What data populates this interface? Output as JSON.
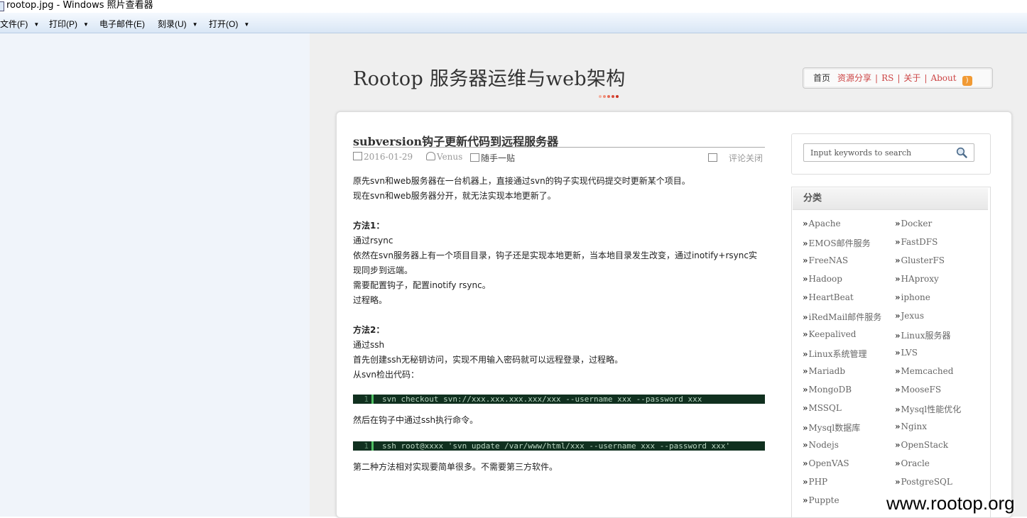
{
  "window": {
    "title": "rootop.jpg - Windows 照片查看器"
  },
  "menubar": [
    {
      "label": "文件(F)",
      "has_dropdown": true
    },
    {
      "label": "打印(P)",
      "has_dropdown": true
    },
    {
      "label": "电子邮件(E)",
      "has_dropdown": false
    },
    {
      "label": "刻录(U)",
      "has_dropdown": true
    },
    {
      "label": "打开(O)",
      "has_dropdown": true
    }
  ],
  "site": {
    "title": "Rootop 服务器运维与web架构",
    "nav": {
      "home": "首页",
      "links": [
        "资源分享",
        "RS",
        "关于",
        "About"
      ],
      "rss_icon": "rss-icon"
    }
  },
  "post": {
    "title": "subversion钩子更新代码到远程服务器",
    "date": "2016-01-29",
    "author": "Venus",
    "category": "随手一贴",
    "comments": "评论关闭",
    "paragraphs": [
      "原先svn和web服务器在一台机器上，直接通过svn的钩子实现代码提交时更新某个项目。",
      "现在svn和web服务器分开，就无法实现本地更新了。",
      "",
      "方法1：",
      "通过rsync",
      "依然在svn服务器上有一个项目目录，钩子还是实现本地更新，当本地目录发生改变，通过inotify+rsync实现同步到远端。",
      "需要配置钩子，配置inotify rsync。",
      "过程略。",
      "",
      "方法2：",
      "通过ssh",
      "首先创建ssh无秘钥访问，实现不用输入密码就可以远程登录，过程略。",
      "从svn检出代码："
    ],
    "code1": {
      "line": "1",
      "text": "svn checkout svn://xxx.xxx.xxx.xxx/xxx --username xxx --password xxx"
    },
    "after_code1": "然后在钩子中通过ssh执行命令。",
    "code2": {
      "line": "1",
      "text": "ssh root@xxxx 'svn update /var/www/html/xxx --username xxx --password xxx'"
    },
    "closing": "第二种方法相对实现要简单很多。不需要第三方软件。"
  },
  "search": {
    "placeholder": "Input keywords to search"
  },
  "categories": {
    "heading": "分类",
    "left": [
      "Apache",
      "EMOS邮件服务",
      "FreeNAS",
      "Hadoop",
      "HeartBeat",
      "iRedMail邮件服务",
      "Keepalived",
      "Linux系统管理",
      "Mariadb",
      "MongoDB",
      "MSSQL",
      "Mysql数据库",
      "Nodejs",
      "OpenVAS",
      "PHP",
      "Puppte"
    ],
    "right": [
      "Docker",
      "FastDFS",
      "GlusterFS",
      "HAproxy",
      "iphone",
      "Jexus",
      "Linux服务器",
      "LVS",
      "Memcached",
      "MooseFS",
      "Mysql性能优化",
      "Nginx",
      "OpenStack",
      "Oracle",
      "PostgreSQL"
    ]
  },
  "watermark": "www.rootop.org",
  "colors": {
    "accent": "#cc4444",
    "code_bg": "#10301f",
    "code_gutter": "#4fbf62",
    "menubar_bg": "#dce8f6"
  }
}
